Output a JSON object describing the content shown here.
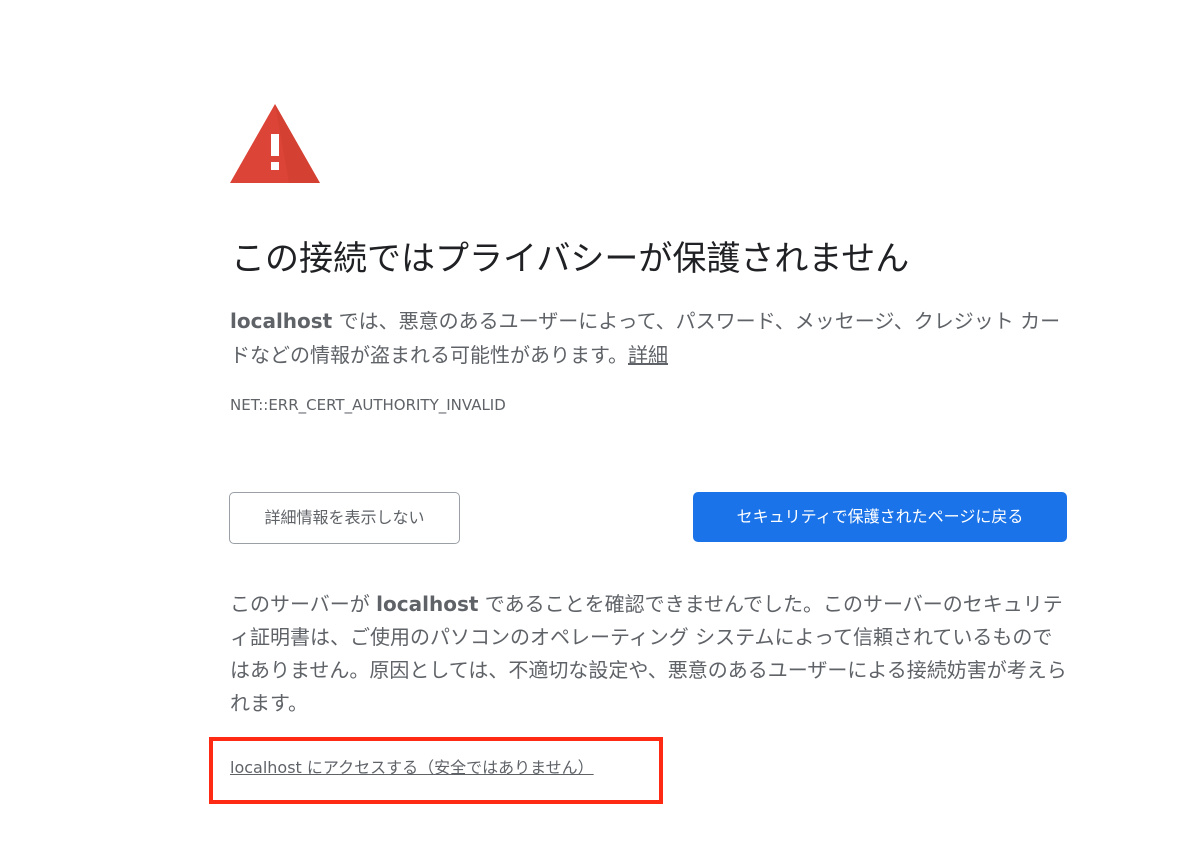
{
  "interstitial": {
    "title": "この接続ではプライバシーが保護されません",
    "summary": {
      "host": "localhost",
      "text": " では、悪意のあるユーザーによって、パスワード、メッセージ、クレジット カードなどの情報が盗まれる可能性があります。",
      "learn_more_link": "詳細"
    },
    "error_code": "NET::ERR_CERT_AUTHORITY_INVALID",
    "buttons": {
      "hide_details": "詳細情報を表示しない",
      "back_to_safety": "セキュリティで保護されたページに戻る"
    },
    "details": {
      "prefix": "このサーバーが ",
      "host": "localhost",
      "text": " であることを確認できませんでした。このサーバーのセキュリティ証明書は、ご使用のパソコンのオペレーティング システムによって信頼されているものではありません。原因としては、不適切な設定や、悪意のあるユーザーによる接続妨害が考えられます。"
    },
    "proceed_link": "localhost にアクセスする（安全ではありません）"
  },
  "icons": {
    "warning": "warning-triangle-icon"
  },
  "colors": {
    "warning_red": "#db4437",
    "primary_button": "#1a73e8",
    "annotation_box": "#ff2a14"
  }
}
